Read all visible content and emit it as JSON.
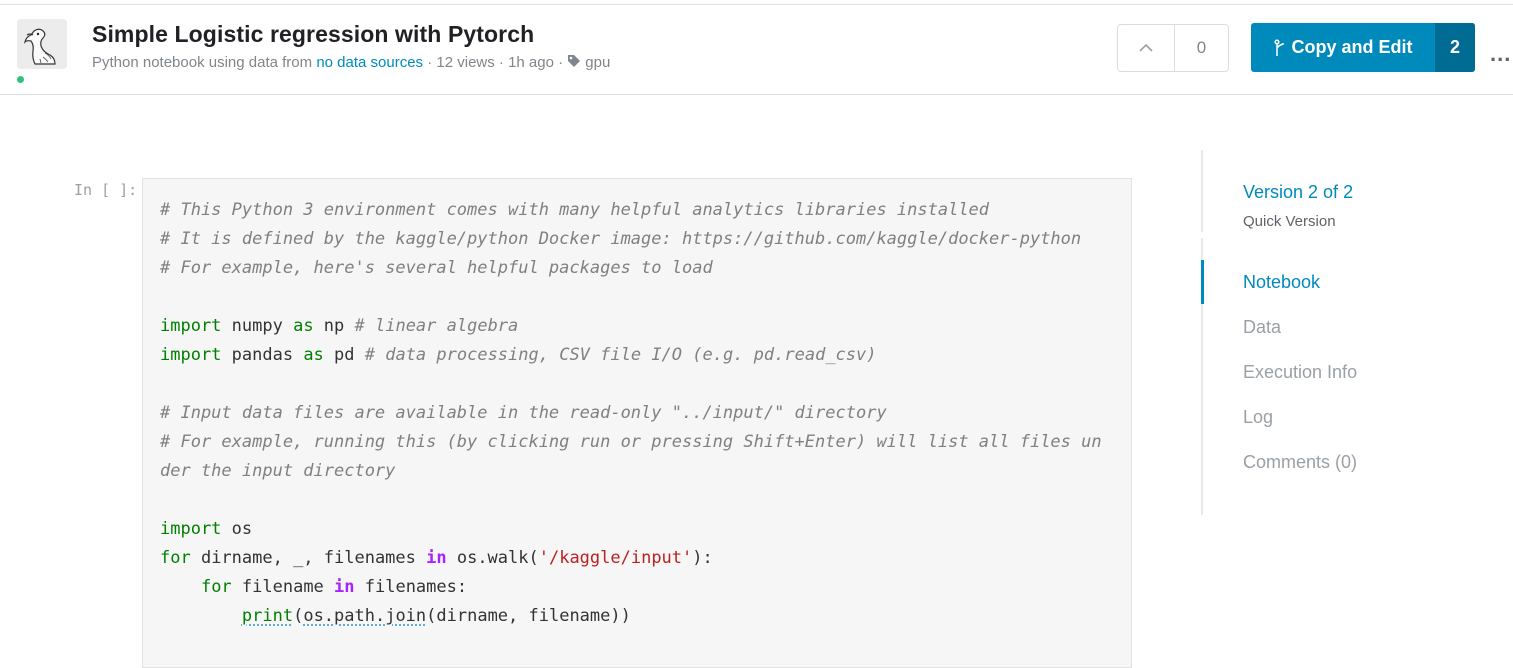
{
  "header": {
    "title": "Simple Logistic regression with Pytorch",
    "meta_prefix": "Python notebook using data from ",
    "meta_link": "no data sources",
    "meta_suffix": " · 12 views · 1h ago · ",
    "tag": "gpu",
    "upvote_count": "0",
    "copy_label": "Copy and Edit",
    "copy_count": "2",
    "more_label": "..."
  },
  "cell": {
    "prompt": "In [ ]:",
    "lines": [
      "# This Python 3 environment comes with many helpful analytics libraries installed",
      "# It is defined by the kaggle/python Docker image: https://github.com/kaggle/docker-python",
      "# For example, here's several helpful packages to load",
      "",
      "import numpy as np # linear algebra",
      "import pandas as pd # data processing, CSV file I/O (e.g. pd.read_csv)",
      "",
      "# Input data files are available in the read-only \"../input/\" directory",
      "# For example, running this (by clicking run or pressing Shift+Enter) will list all files un",
      "der the input directory",
      "",
      "import os",
      "for dirname, _, filenames in os.walk('/kaggle/input'):",
      "    for filename in filenames:",
      "        print(os.path.join(dirname, filename))"
    ]
  },
  "sidebar": {
    "version": "Version 2 of 2",
    "version_type": "Quick Version",
    "nav": [
      "Notebook",
      "Data",
      "Execution Info",
      "Log",
      "Comments (0)"
    ],
    "active": "Notebook"
  },
  "colors": {
    "accent": "#008abc",
    "status": "#2ec27e"
  }
}
